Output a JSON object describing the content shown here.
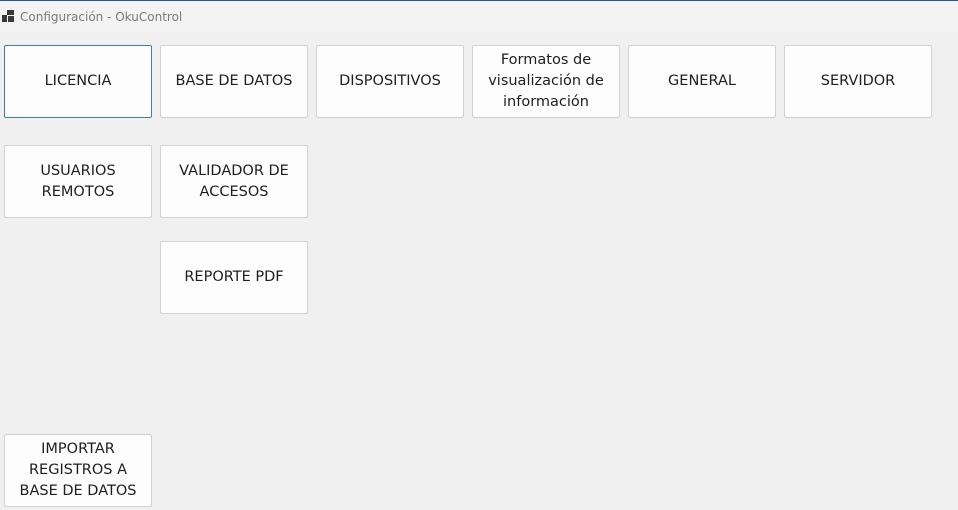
{
  "window": {
    "title": "Configuración - OkuControl",
    "icon": "app-windows-icon"
  },
  "tiles": {
    "licencia": "LICENCIA",
    "base_de_datos": "BASE DE DATOS",
    "dispositivos": "DISPOSITIVOS",
    "formatos": "Formatos de visualización de información",
    "general": "GENERAL",
    "servidor": "SERVIDOR",
    "usuarios_remotos": "USUARIOS REMOTOS",
    "validador_accesos": "VALIDADOR DE ACCESOS",
    "reporte_pdf": "REPORTE PDF",
    "importar_registros": "IMPORTAR REGISTROS A BASE DE DATOS"
  },
  "colors": {
    "background": "#f0f0f0",
    "tile_background": "#fdfdfd",
    "tile_border": "#d2d2d2",
    "focus_border": "#3c7bc4"
  }
}
